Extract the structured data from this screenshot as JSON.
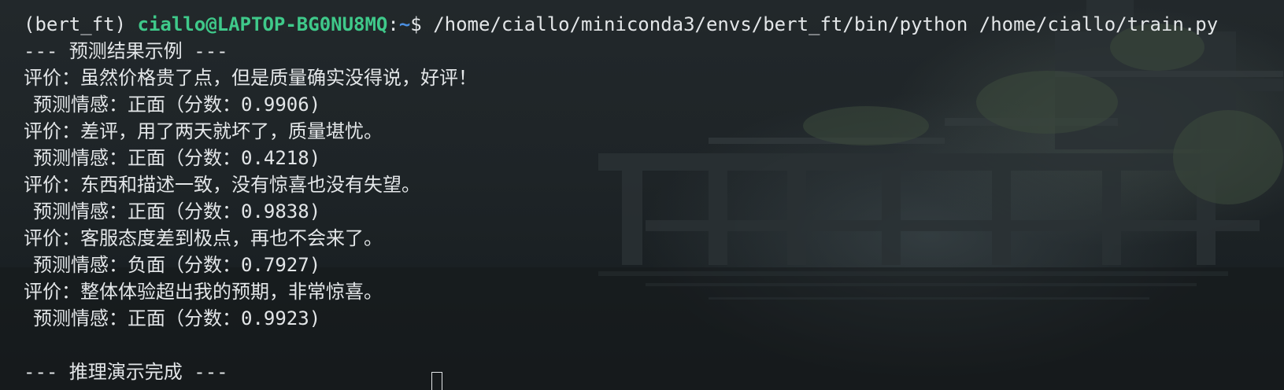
{
  "prompt": {
    "env": "(bert_ft)",
    "user_host": "ciallo@LAPTOP-BG0NU8MQ",
    "separator": ":",
    "path": "~",
    "symbol": "$",
    "command": "/home/ciallo/miniconda3/envs/bert_ft/bin/python /home/ciallo/train.py"
  },
  "output": {
    "header": "--- 预测结果示例 ---",
    "results": [
      {
        "review": "评价：虽然价格贵了点，但是质量确实没得说，好评！",
        "prediction": "预测情感：正面（分数：0.9906)"
      },
      {
        "review": "评价：差评，用了两天就坏了，质量堪忧。",
        "prediction": "预测情感：正面（分数：0.4218)"
      },
      {
        "review": "评价：东西和描述一致，没有惊喜也没有失望。",
        "prediction": "预测情感：正面（分数：0.9838)"
      },
      {
        "review": "评价：客服态度差到极点，再也不会来了。",
        "prediction": "预测情感：负面（分数：0.7927)"
      },
      {
        "review": "评价：整体体验超出我的预期，非常惊喜。",
        "prediction": "预测情感：正面（分数：0.9923)"
      }
    ],
    "footer": "--- 推理演示完成 ---"
  },
  "colors": {
    "text": "#e3e6e8",
    "user_host": "#3fc98a",
    "path": "#4b8fe0",
    "background": "#1b1f22"
  }
}
